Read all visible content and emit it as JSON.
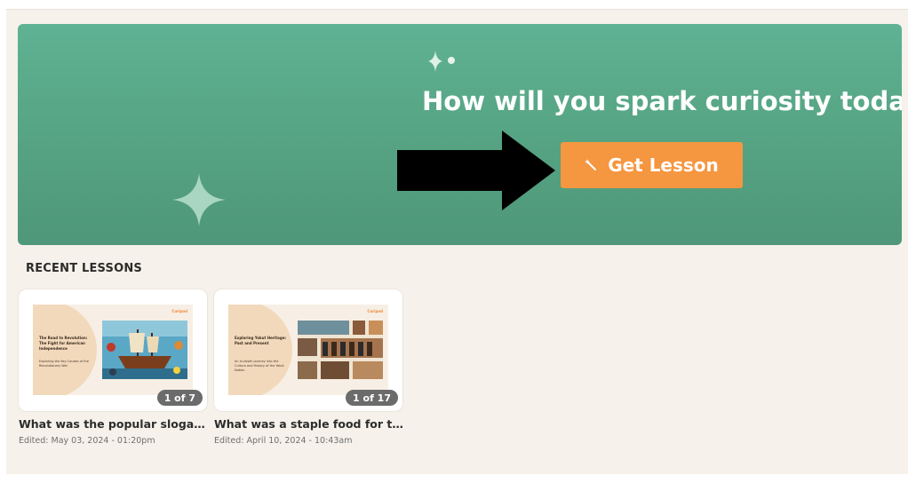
{
  "hero": {
    "headline": "How will you spark curiosity today?",
    "cta_label": "Get Lesson",
    "colors": {
      "background": "#58a785",
      "cta": "#f59640",
      "text": "#ffffff"
    }
  },
  "overlay": {
    "arrow_color": "#000000"
  },
  "recent": {
    "title": "RECENT LESSONS",
    "lessons": [
      {
        "title": "What was the popular slogan th...",
        "edited": "Edited: May 03, 2024 - 01:20pm",
        "slide_count": "1 of 7",
        "thumbnail": {
          "brand": "Curipod",
          "title": "The Road to Revolution: The Fight for American Independence",
          "subtitle": "Exploring the Key Causes of the Revolutionary War"
        }
      },
      {
        "title": "What was a staple food for the...",
        "edited": "Edited: April 10, 2024 - 10:43am",
        "slide_count": "1 of 17",
        "thumbnail": {
          "brand": "Curipod",
          "title": "Exploring Yokut Heritage: Past and Present",
          "subtitle": "An In-depth Journey into the Culture and History of the Yokut Nation"
        }
      }
    ]
  }
}
